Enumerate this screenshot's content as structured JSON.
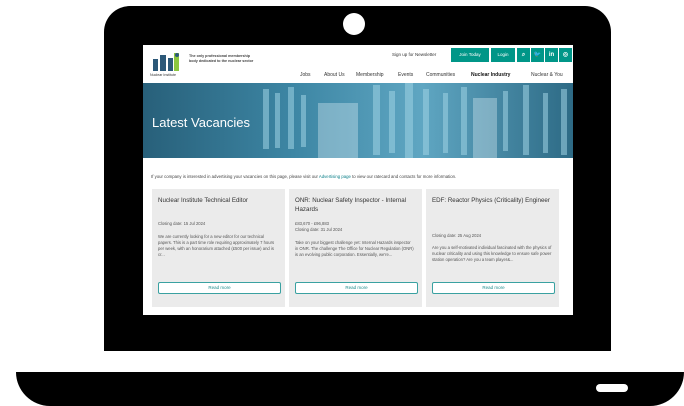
{
  "header": {
    "logo_caption": "Nuclear Institute",
    "tagline": "The only professional membership body dedicated to the nuclear sector",
    "newsletter": "Sign up for Newsletter",
    "join": "Join Today",
    "login": "Login",
    "icons": [
      "search-icon",
      "twitter-icon",
      "linkedin-icon",
      "instagram-icon"
    ],
    "icon_glyphs": [
      "⌕",
      "🐦",
      "in",
      "◎"
    ],
    "brand_color": "#009688"
  },
  "nav": [
    "Jobs",
    "About Us",
    "Membership",
    "Events",
    "Communities",
    "Nuclear Industry",
    "Nuclear & You"
  ],
  "hero": {
    "title": "Latest Vacancies"
  },
  "intro": {
    "before": "If your company is interested in advertising your vacancies on this page, please visit our ",
    "link": "Advertising page",
    "after": " to view our ratecard and contacts for more information."
  },
  "cards": [
    {
      "title": "Nuclear Institute Technical Editor",
      "salary": "",
      "closing": "Closing date: 15 Jul 2024",
      "body": "We are currently looking for a new editor for our technical papers. This is a part time role requiring approximately 7 hours per week, with an honorarium attached (£500 per issue) and is cr...",
      "cta": "Read more"
    },
    {
      "title": "ONR: Nuclear Safety Inspector - Internal Hazards",
      "salary": "£83,670 - £96,883",
      "closing": "Closing date: 31 Jul 2024",
      "body": "Take on your biggest challenge yet: Internal Hazards inspector in ONR. The challenge The Office for Nuclear Regulation (ONR) is an evolving public corporation. Essentially, we're...",
      "cta": "Read more"
    },
    {
      "title": "EDF: Reactor Physics (Criticality) Engineer",
      "salary": "",
      "closing": "Closing date: 25 Aug 2024",
      "body": "Are you a self-motivated individual fascinated with the physics of nuclear criticality and using this knowledge to ensure safe power station operation? Are you a team player&...",
      "cta": "Read more"
    }
  ]
}
